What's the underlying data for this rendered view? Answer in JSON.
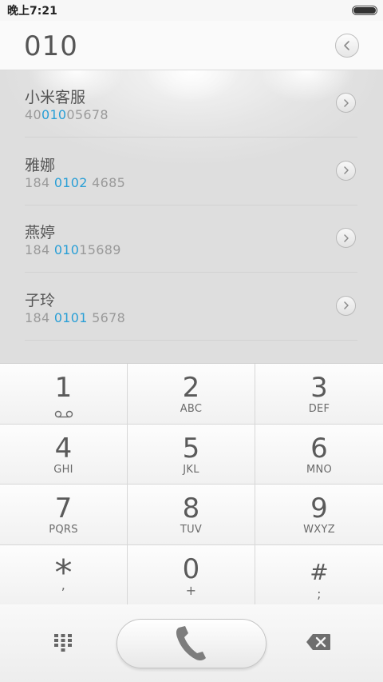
{
  "status_bar": {
    "time": "晚上7:21",
    "battery_level": 1.0
  },
  "dialer": {
    "input_value": "010"
  },
  "results": [
    {
      "name": "小米客服",
      "number_parts": [
        "40",
        "010",
        "05678"
      ]
    },
    {
      "name": "雅娜",
      "number_parts": [
        "184 ",
        "0102",
        " 4685"
      ]
    },
    {
      "name": "燕婷",
      "number_parts": [
        "184 ",
        "010",
        "15689"
      ]
    },
    {
      "name": "子玲",
      "number_parts": [
        "184 ",
        "0101",
        " 5678"
      ]
    }
  ],
  "keypad": [
    {
      "digit": "1",
      "sub": "",
      "icon": "voicemail-icon"
    },
    {
      "digit": "2",
      "sub": "ABC"
    },
    {
      "digit": "3",
      "sub": "DEF"
    },
    {
      "digit": "4",
      "sub": "GHI"
    },
    {
      "digit": "5",
      "sub": "JKL"
    },
    {
      "digit": "6",
      "sub": "MNO"
    },
    {
      "digit": "7",
      "sub": "PQRS"
    },
    {
      "digit": "8",
      "sub": "TUV"
    },
    {
      "digit": "9",
      "sub": "WXYZ"
    },
    {
      "digit": "*",
      "sub": ","
    },
    {
      "digit": "0",
      "sub": "+"
    },
    {
      "digit": "#",
      "sub": ";"
    }
  ],
  "bottom_bar": {
    "left_icon": "dialpad-icon",
    "call_icon": "phone-icon",
    "right_icon": "backspace-icon"
  },
  "colors": {
    "highlight": "#2a9fd6",
    "background": "#f2f2f2"
  }
}
